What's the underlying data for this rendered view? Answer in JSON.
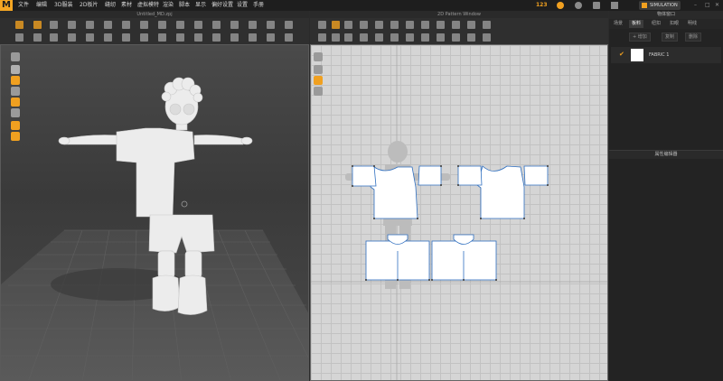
{
  "menubar": {
    "logo": "M",
    "items": [
      "文件",
      "编辑",
      "3D服装",
      "2D板片",
      "缝纫",
      "素材",
      "虚拟模特",
      "渲染",
      "脚本",
      "显示",
      "偏好设置",
      "设置",
      "手册"
    ],
    "counter": "123",
    "simulation_label": "SIMULATION"
  },
  "viewport3d": {
    "title": "Untitled_MD.zpj"
  },
  "viewport2d": {
    "title": "2D Pattern Window"
  },
  "object_browser": {
    "title": "物体窗口",
    "tabs": [
      "场景",
      "板料",
      "纽扣",
      "扣眼",
      "明线"
    ],
    "active_tab": 1,
    "buttons": [
      "+ 增加",
      "复制",
      "删除"
    ],
    "fabric_name": "FABRIC 1"
  },
  "property_editor": {
    "title": "属性编辑器"
  },
  "colors": {
    "accent": "#f0a020",
    "pattern_outline": "#2f6fc0"
  }
}
